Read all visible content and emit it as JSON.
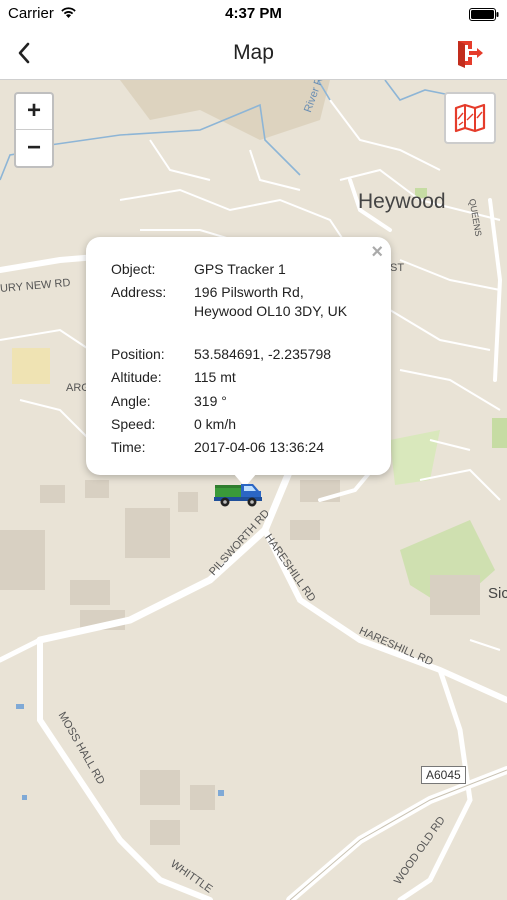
{
  "status": {
    "carrier": "Carrier",
    "time": "4:37 PM"
  },
  "nav": {
    "title": "Map"
  },
  "map": {
    "zoom_in": "+",
    "zoom_out": "−",
    "labels": {
      "heywood": "Heywood",
      "river": "River Ro",
      "bury_new_rd": "URY NEW RD",
      "arg": "ARG",
      "pilsworth_rd": "PILSWORTH RD",
      "hareshill_rd_1": "HARESHILL RD",
      "hareshill_rd_2": "HARESHILL RD",
      "moss_hall_rd": "MOSS HALL RD",
      "whittle": "WHITTLE",
      "a6045": "A6045",
      "wood_old_rd": "WOOD OLD RD",
      "queens": "QUEENS",
      "st": "ST",
      "sic": "Sic"
    }
  },
  "popup": {
    "close": "×",
    "rows": [
      {
        "key": "Object:",
        "value": "GPS Tracker 1"
      },
      {
        "key": "Address:",
        "value": "196 Pilsworth Rd, Heywood OL10 3DY, UK"
      },
      {
        "key": "Position:",
        "value": "53.584691, -2.235798"
      },
      {
        "key": "Altitude:",
        "value": "115 mt"
      },
      {
        "key": "Angle:",
        "value": "319 °"
      },
      {
        "key": "Speed:",
        "value": "0 km/h"
      },
      {
        "key": "Time:",
        "value": "2017-04-06 13:36:24"
      }
    ]
  }
}
